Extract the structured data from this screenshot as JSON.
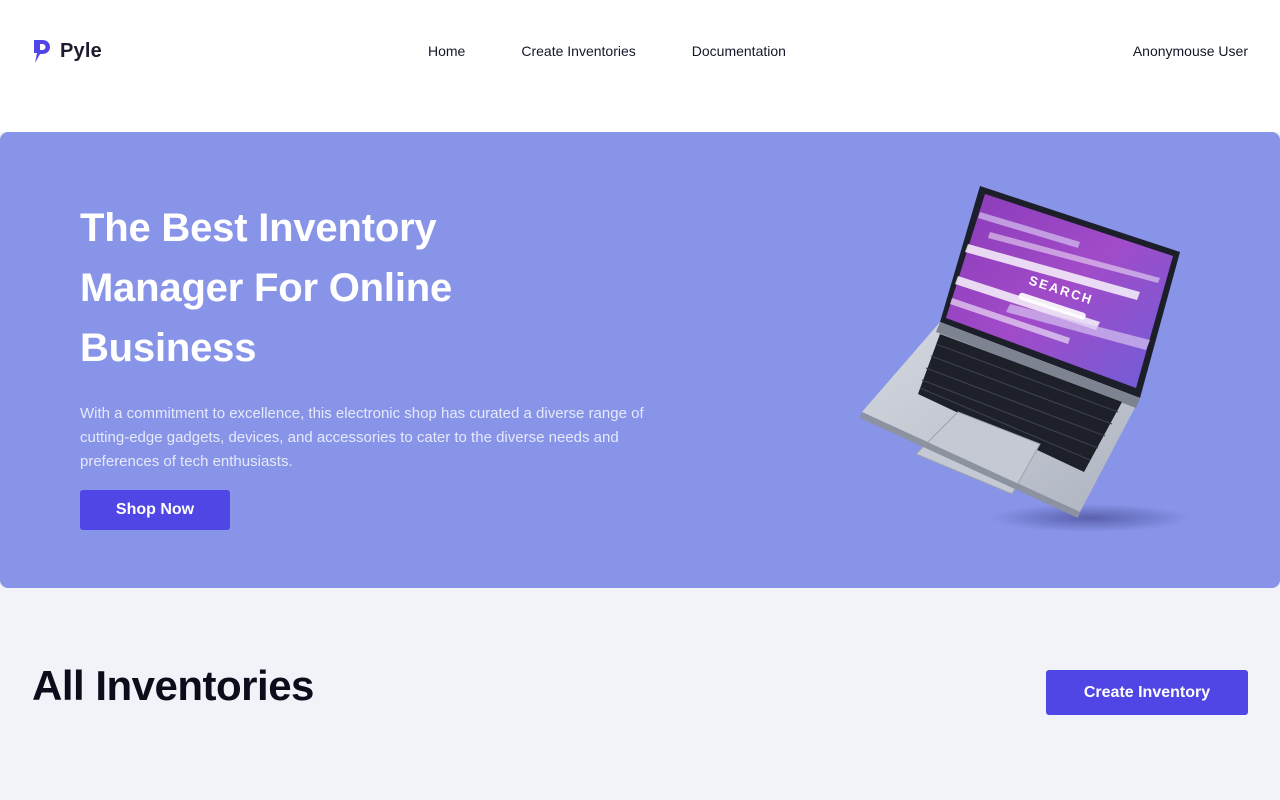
{
  "header": {
    "brand": "Pyle",
    "nav": [
      "Home",
      "Create Inventories",
      "Documentation"
    ],
    "user": "Anonymouse User"
  },
  "hero": {
    "title": "The Best Inventory Manager For Online Business",
    "description": "With a commitment to excellence, this electronic shop has curated a diverse range of cutting-edge gadgets, devices, and accessories to cater to the diverse needs and preferences of tech enthusiasts.",
    "button": "Shop Now",
    "screen_text": "SEARCH"
  },
  "inventories": {
    "title": "All Inventories",
    "create_button": "Create Inventory"
  },
  "colors": {
    "accent": "#4f46e5",
    "hero_bg": "#8794e8",
    "page_bg": "#f1f3f8"
  }
}
